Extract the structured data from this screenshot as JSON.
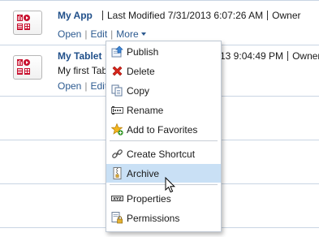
{
  "items": [
    {
      "name": "My App",
      "last_modified": "Last Modified 7/31/2013 6:07:26 AM",
      "owner": "Owner",
      "actions": {
        "open": "Open",
        "edit": "Edit",
        "more": "More"
      }
    },
    {
      "name": "My Tablet",
      "last_modified_visible": "13 9:04:49 PM",
      "owner": "Owner",
      "description": "My first Tab",
      "actions": {
        "open": "Open",
        "edit": "Edit"
      }
    }
  ],
  "menu": {
    "items": [
      {
        "label": "Publish",
        "icon": "publish-icon"
      },
      {
        "label": "Delete",
        "icon": "delete-icon"
      },
      {
        "label": "Copy",
        "icon": "copy-icon"
      },
      {
        "label": "Rename",
        "icon": "rename-icon"
      },
      {
        "label": "Add to Favorites",
        "icon": "add-favorite-icon"
      },
      {
        "label": "Create Shortcut",
        "icon": "shortcut-icon"
      },
      {
        "label": "Archive",
        "icon": "archive-icon",
        "highlighted": true
      },
      {
        "label": "Properties",
        "icon": "properties-icon"
      },
      {
        "label": "Permissions",
        "icon": "permissions-icon"
      }
    ]
  },
  "colors": {
    "link": "#21508a",
    "highlight": "#c9e0f5",
    "icon_red": "#c8102e"
  }
}
